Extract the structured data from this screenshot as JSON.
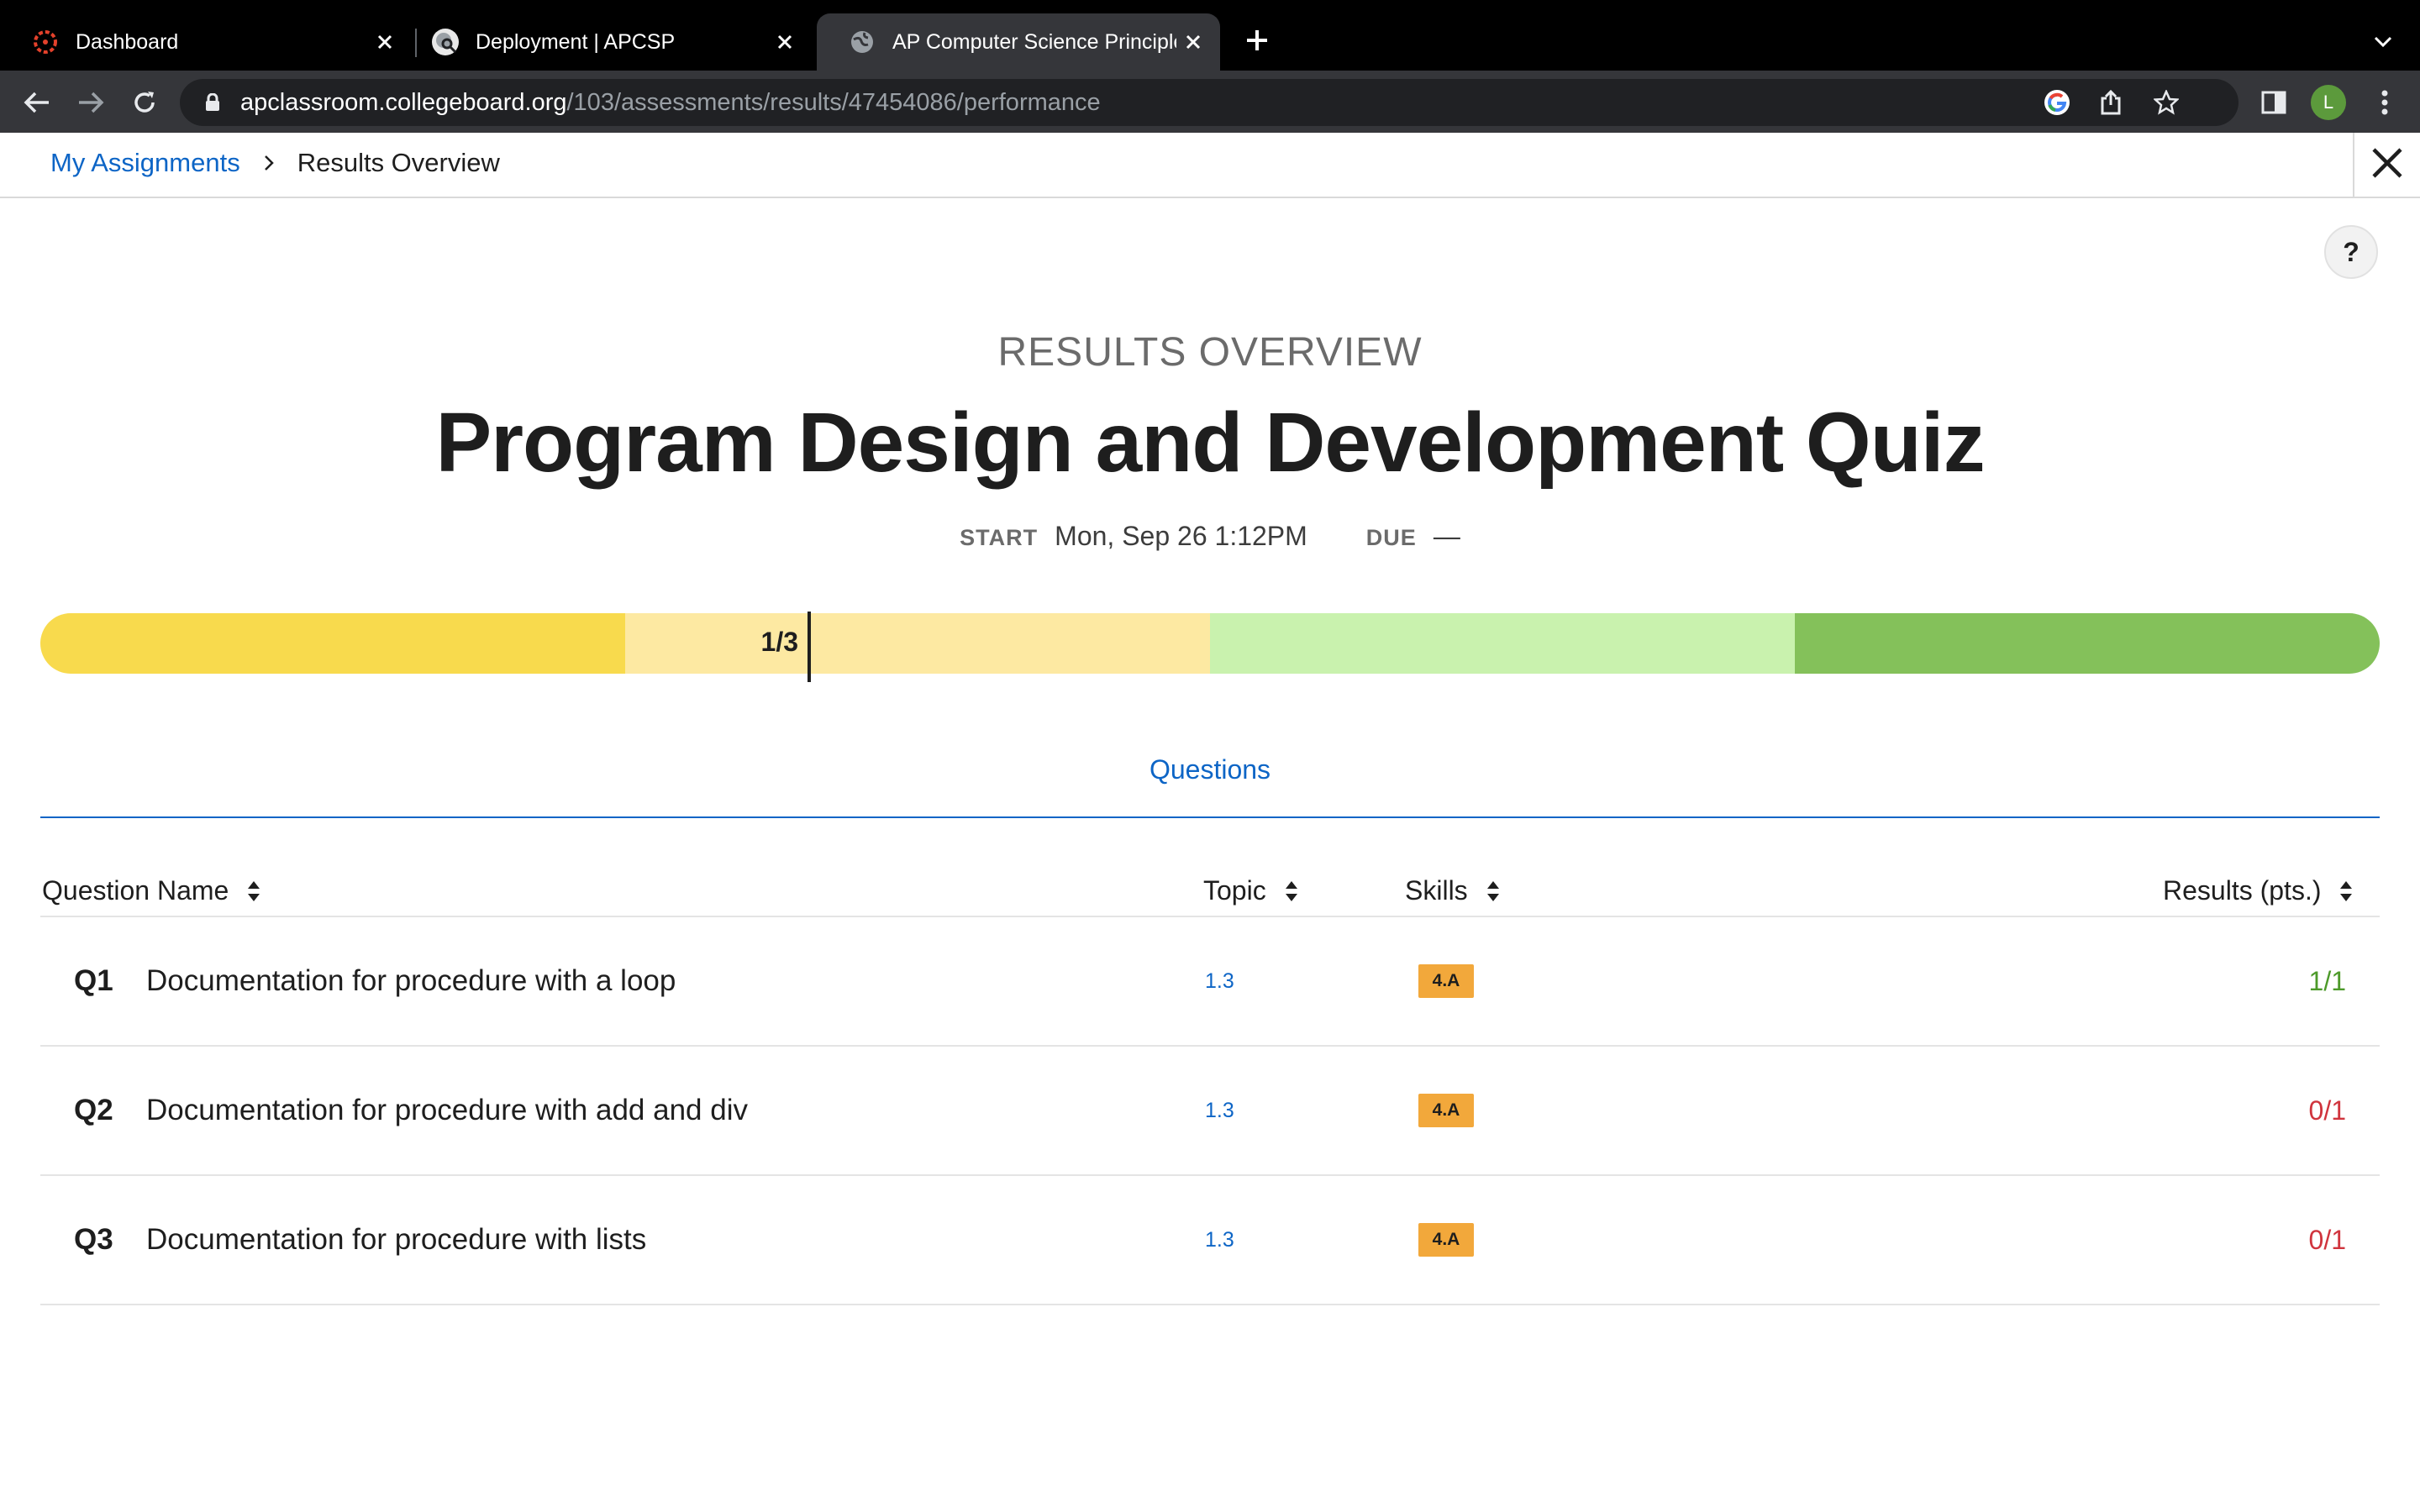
{
  "browser": {
    "tabs": [
      {
        "label": "Dashboard",
        "icon": "canvas-logo-icon"
      },
      {
        "label": "Deployment | APCSP",
        "icon": "globe-search-icon"
      },
      {
        "label": "AP Computer Science Principle",
        "icon": "globe-icon",
        "active": true
      }
    ],
    "url_host": "apclassroom.collegeboard.org",
    "url_path": "/103/assessments/results/47454086/performance",
    "profile_initial": "L"
  },
  "breadcrumb": {
    "link": "My Assignments",
    "current": "Results Overview"
  },
  "header": {
    "eyebrow": "RESULTS OVERVIEW",
    "title": "Program Design and Development Quiz",
    "start_label": "START",
    "start_value": "Mon, Sep 26 1:12PM",
    "due_label": "DUE",
    "due_value": "—"
  },
  "performance": {
    "score_label": "1/3",
    "score_fraction": 0.333,
    "segment_colors": [
      "#f8da4d",
      "#fde9a2",
      "#c9f2ae",
      "#84c15a"
    ]
  },
  "section_tab": "Questions",
  "table": {
    "columns": {
      "name": "Question Name",
      "topic": "Topic",
      "skills": "Skills",
      "results": "Results (pts.)"
    },
    "rows": [
      {
        "num": "Q1",
        "name": "Documentation for procedure with a loop",
        "topic": "1.3",
        "skill": "4.A",
        "result": "1/1",
        "status": "correct"
      },
      {
        "num": "Q2",
        "name": "Documentation for procedure with add and div",
        "topic": "1.3",
        "skill": "4.A",
        "result": "0/1",
        "status": "incorrect"
      },
      {
        "num": "Q3",
        "name": "Documentation for procedure with lists",
        "topic": "1.3",
        "skill": "4.A",
        "result": "0/1",
        "status": "incorrect"
      }
    ]
  },
  "colors": {
    "link_blue": "#0d65c6",
    "skill_badge": "#f2a83b",
    "correct_green": "#4d9a2a",
    "incorrect_red": "#d0343d"
  }
}
